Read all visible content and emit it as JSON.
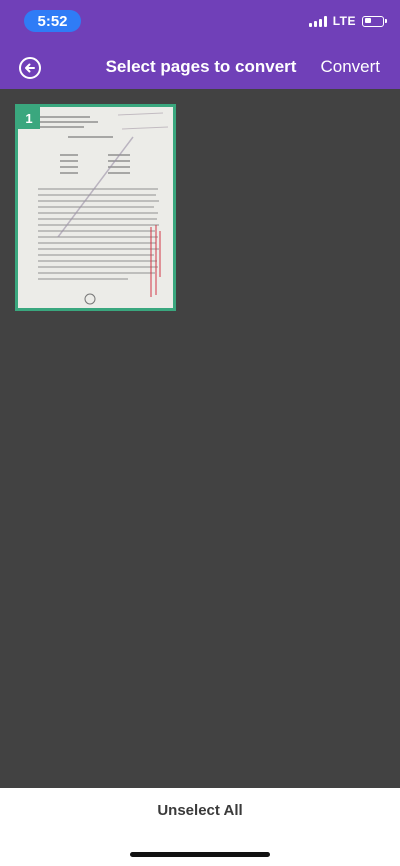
{
  "status": {
    "time": "5:52",
    "network": "LTE",
    "battery_level": 0.4
  },
  "header": {
    "title": "Select pages to convert",
    "convert_label": "Convert",
    "back_icon": "back-arrow-icon"
  },
  "pages": [
    {
      "number": "1",
      "selected": true
    }
  ],
  "footer": {
    "unselect_label": "Unselect All"
  },
  "colors": {
    "header": "#7040b8",
    "background": "#424242",
    "selection": "#3aa77e",
    "time_pill": "#2f7cf6"
  }
}
